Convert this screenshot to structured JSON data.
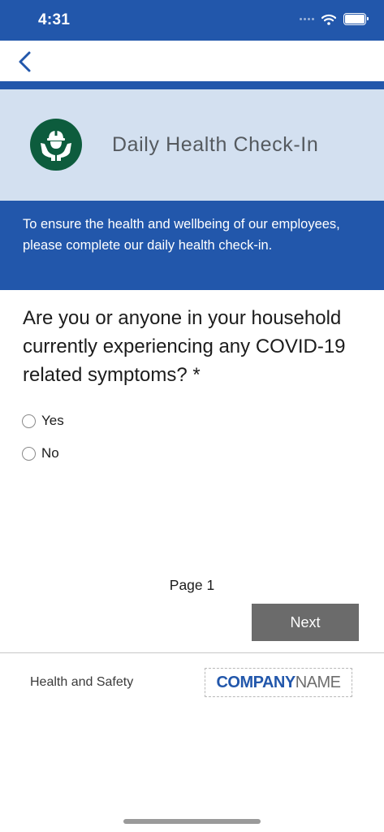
{
  "status_bar": {
    "time": "4:31"
  },
  "banner": {
    "title": "Daily Health Check-In"
  },
  "intro": {
    "text": "To ensure the health and wellbeing of our employees, please complete our daily health check-in."
  },
  "question": {
    "text": "Are you or anyone in your household currently experiencing any COVID-19 related symptoms? *",
    "options": [
      {
        "label": "Yes",
        "selected": false
      },
      {
        "label": "No",
        "selected": false
      }
    ]
  },
  "pagination": {
    "page_label": "Page 1",
    "next_label": "Next"
  },
  "footer": {
    "text": "Health and Safety",
    "logo_bold": "COMPANY",
    "logo_light": "NAME"
  },
  "colors": {
    "brand_blue": "#2257ab",
    "banner_bg": "#d3e0f0",
    "logo_green": "#0d5c3d",
    "button_gray": "#6b6b6b"
  },
  "icons": [
    "back-chevron-icon",
    "wifi-icon",
    "battery-icon",
    "worker-hands-icon"
  ]
}
